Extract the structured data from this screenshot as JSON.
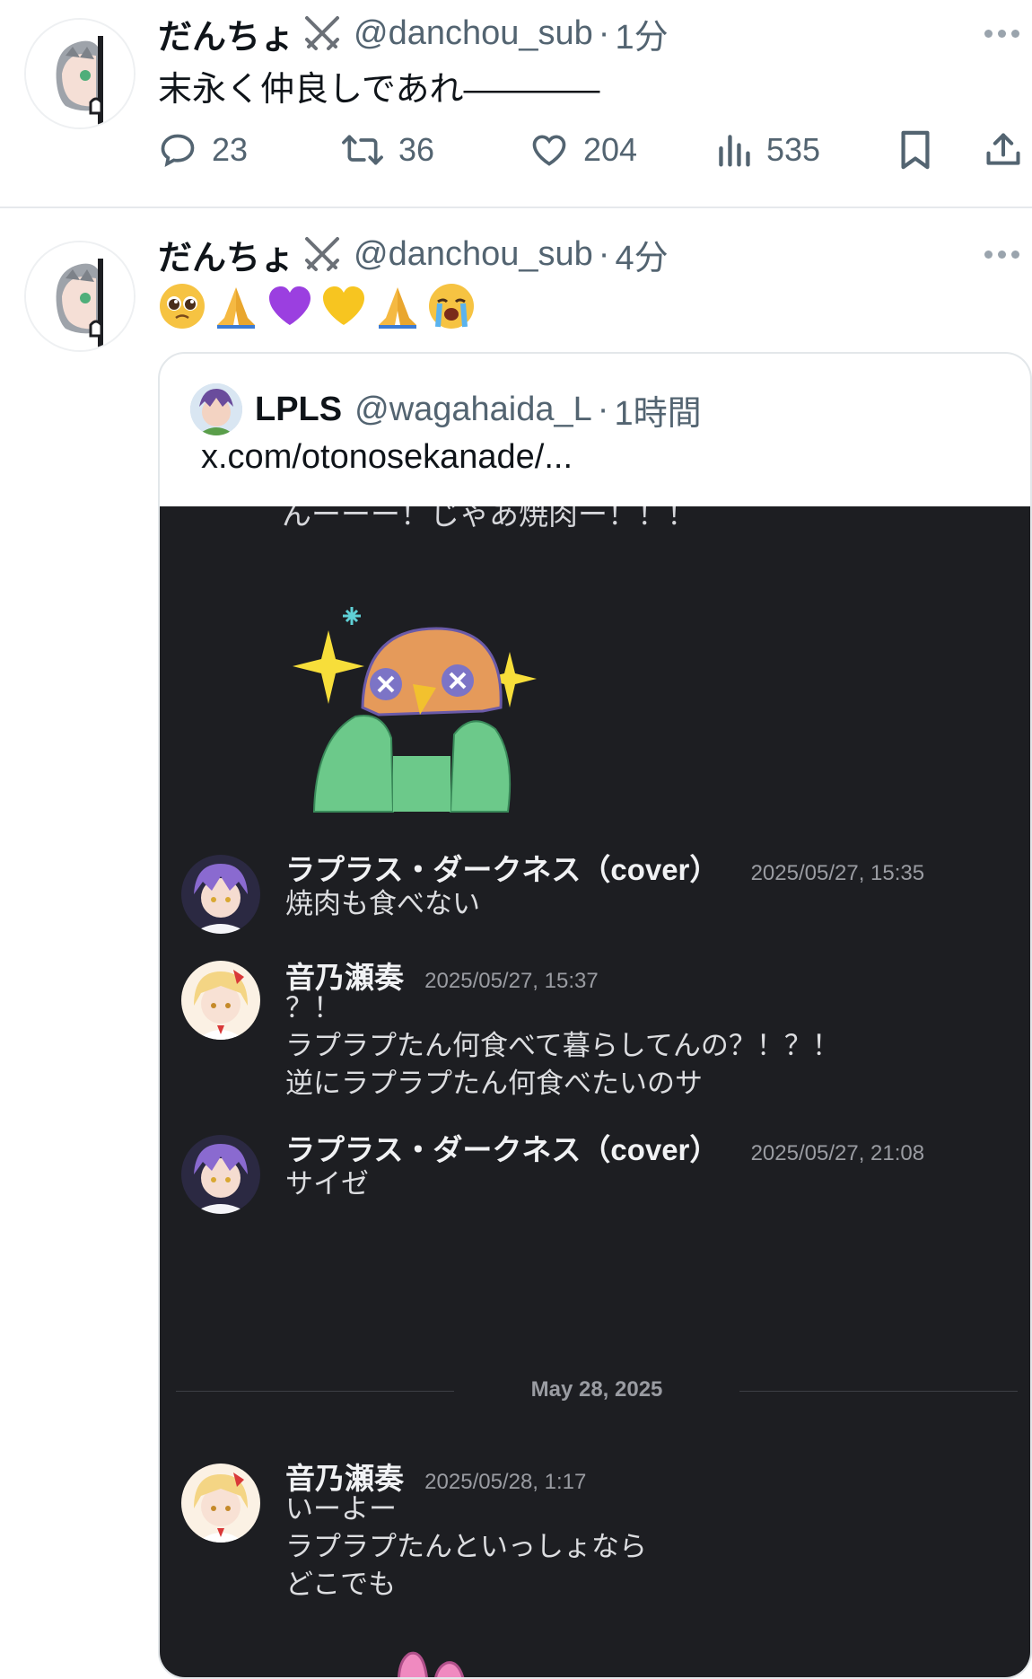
{
  "tweets": [
    {
      "display_name": "だんちょ",
      "handle": "@danchou_sub",
      "separator": "·",
      "time": "1分",
      "text": "末永く仲良しであれ————",
      "stats": {
        "replies": "23",
        "retweets": "36",
        "likes": "204",
        "views": "535"
      }
    },
    {
      "display_name": "だんちょ",
      "handle": "@danchou_sub",
      "separator": "·",
      "time": "4分",
      "emojis": [
        "pleading-face",
        "folded-hands",
        "purple-heart",
        "yellow-heart",
        "folded-hands",
        "loudly-crying-face"
      ],
      "quote": {
        "display_name": "LPLS",
        "handle": "@wagahaida_L",
        "separator": "·",
        "time": "1時間",
        "text": "x.com/otonosekanade/...",
        "chat": {
          "cut_line": "んーーー！じゃあ焼肉ー！！！",
          "messages": [
            {
              "author": "ラプラス・ダークネス（cover）",
              "timestamp": "2025/05/27, 15:35",
              "lines": [
                "焼肉も食べない"
              ]
            },
            {
              "author": "音乃瀬奏",
              "timestamp": "2025/05/27, 15:37",
              "lines": [
                "？！",
                "ラプラプたん何食べて暮らしてんの？！？！",
                "逆にラプラプたん何食べたいのサ"
              ]
            },
            {
              "author": "ラプラス・ダークネス（cover）",
              "timestamp": "2025/05/27, 21:08",
              "lines": [
                "サイゼ"
              ]
            },
            {
              "author": "音乃瀬奏",
              "timestamp": "2025/05/28, 1:17",
              "lines": [
                "いーよー",
                "ラプラプたんといっしょなら",
                "どこでも"
              ]
            }
          ],
          "date_divider": "May 28, 2025"
        }
      }
    }
  ],
  "colors": {
    "text_primary": "#0f1419",
    "text_secondary": "#536471",
    "chat_bg": "#1d1e22",
    "chat_text": "#dcdde0",
    "chat_meta": "#9a9ca2"
  }
}
